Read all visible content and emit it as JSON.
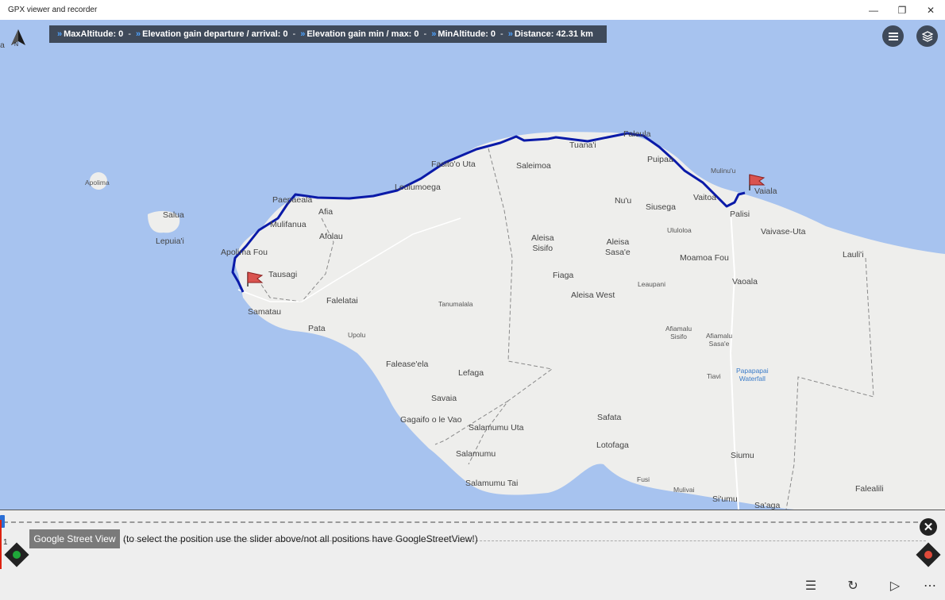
{
  "window": {
    "title": "GPX viewer and recorder",
    "minimize_glyph": "—",
    "restore_glyph": "❐",
    "close_glyph": "✕"
  },
  "stats": {
    "chevron": "»",
    "items": [
      {
        "label": "MaxAltitude: 0"
      },
      {
        "label": "Elevation gain departure / arrival: 0"
      },
      {
        "label": "Elevation gain min / max: 0"
      },
      {
        "label": "MinAltitude: 0"
      },
      {
        "label": "Distance: 42.31 km"
      }
    ],
    "separator": "-"
  },
  "map": {
    "north_label": "N",
    "marker_start": "A",
    "marker_end": "B",
    "places": [
      {
        "name": "Apolima",
        "cls": "small"
      },
      {
        "name": "Salua"
      },
      {
        "name": "Lepuia'i"
      },
      {
        "name": "Paepaeala"
      },
      {
        "name": "Afia"
      },
      {
        "name": "Mulifanua"
      },
      {
        "name": "Afolau"
      },
      {
        "name": "Apolima Fou"
      },
      {
        "name": "Tausagi"
      },
      {
        "name": "Falelatai"
      },
      {
        "name": "Samatau"
      },
      {
        "name": "Pata"
      },
      {
        "name": "Upolu",
        "cls": "small"
      },
      {
        "name": "Falease'ela"
      },
      {
        "name": "Lefaga"
      },
      {
        "name": "Savaia"
      },
      {
        "name": "Gagaifo o le Vao"
      },
      {
        "name": "Salamumu Uta"
      },
      {
        "name": "Salamumu"
      },
      {
        "name": "Salamumu Tai"
      },
      {
        "name": "Fasito'o Uta"
      },
      {
        "name": "Leulumoega"
      },
      {
        "name": "Saleimoa"
      },
      {
        "name": "Tuana'i"
      },
      {
        "name": "Faleula"
      },
      {
        "name": "Puipaa"
      },
      {
        "name": "Mulinu'u",
        "cls": "small"
      },
      {
        "name": "Vaiala"
      },
      {
        "name": "Vaitoa"
      },
      {
        "name": "Palisi"
      },
      {
        "name": "Nu'u"
      },
      {
        "name": "Siusega"
      },
      {
        "name": "Ululoloa",
        "cls": "small"
      },
      {
        "name": "Vaivase-Uta"
      },
      {
        "name": "Lauli'i"
      },
      {
        "name": "Aleisa Sisifo"
      },
      {
        "name": "Aleisa Sasa'e"
      },
      {
        "name": "Moamoa Fou"
      },
      {
        "name": "Fiaga"
      },
      {
        "name": "Leaupani",
        "cls": "small"
      },
      {
        "name": "Vaoala"
      },
      {
        "name": "Aleisa West"
      },
      {
        "name": "Tanumalala",
        "cls": "small"
      },
      {
        "name": "Afiamalu Sisifo",
        "cls": "small"
      },
      {
        "name": "Afiamalu Sasa'e",
        "cls": "small"
      },
      {
        "name": "Tiavi",
        "cls": "small"
      },
      {
        "name": "Papapapai Waterfall",
        "cls": "water"
      },
      {
        "name": "Safata"
      },
      {
        "name": "Lotofaga"
      },
      {
        "name": "Siumu"
      },
      {
        "name": "Fusi",
        "cls": "small"
      },
      {
        "name": "Mulivai",
        "cls": "small"
      },
      {
        "name": "Si'umu"
      },
      {
        "name": "Sa'aga"
      },
      {
        "name": "Falealili"
      },
      {
        "name": "a"
      }
    ]
  },
  "panel": {
    "index_label": "1",
    "gsv_button": "Google Street View",
    "hint": "(to select the position use the slider above/not all positions have GoogleStreetView!)",
    "close_glyph": "✕"
  },
  "colors": {
    "track": "#0a1aa8",
    "stats_bg": "#3f4a5a",
    "chevron": "#4ea3ff",
    "water": "#a7c3ef",
    "land": "#eeeeec",
    "start_dot": "#1fa83a",
    "end_dot": "#e04a3a"
  },
  "commands": {
    "list_glyph": "☰",
    "refresh_glyph": "↻",
    "play_glyph": "▷",
    "more_glyph": "⋯"
  }
}
